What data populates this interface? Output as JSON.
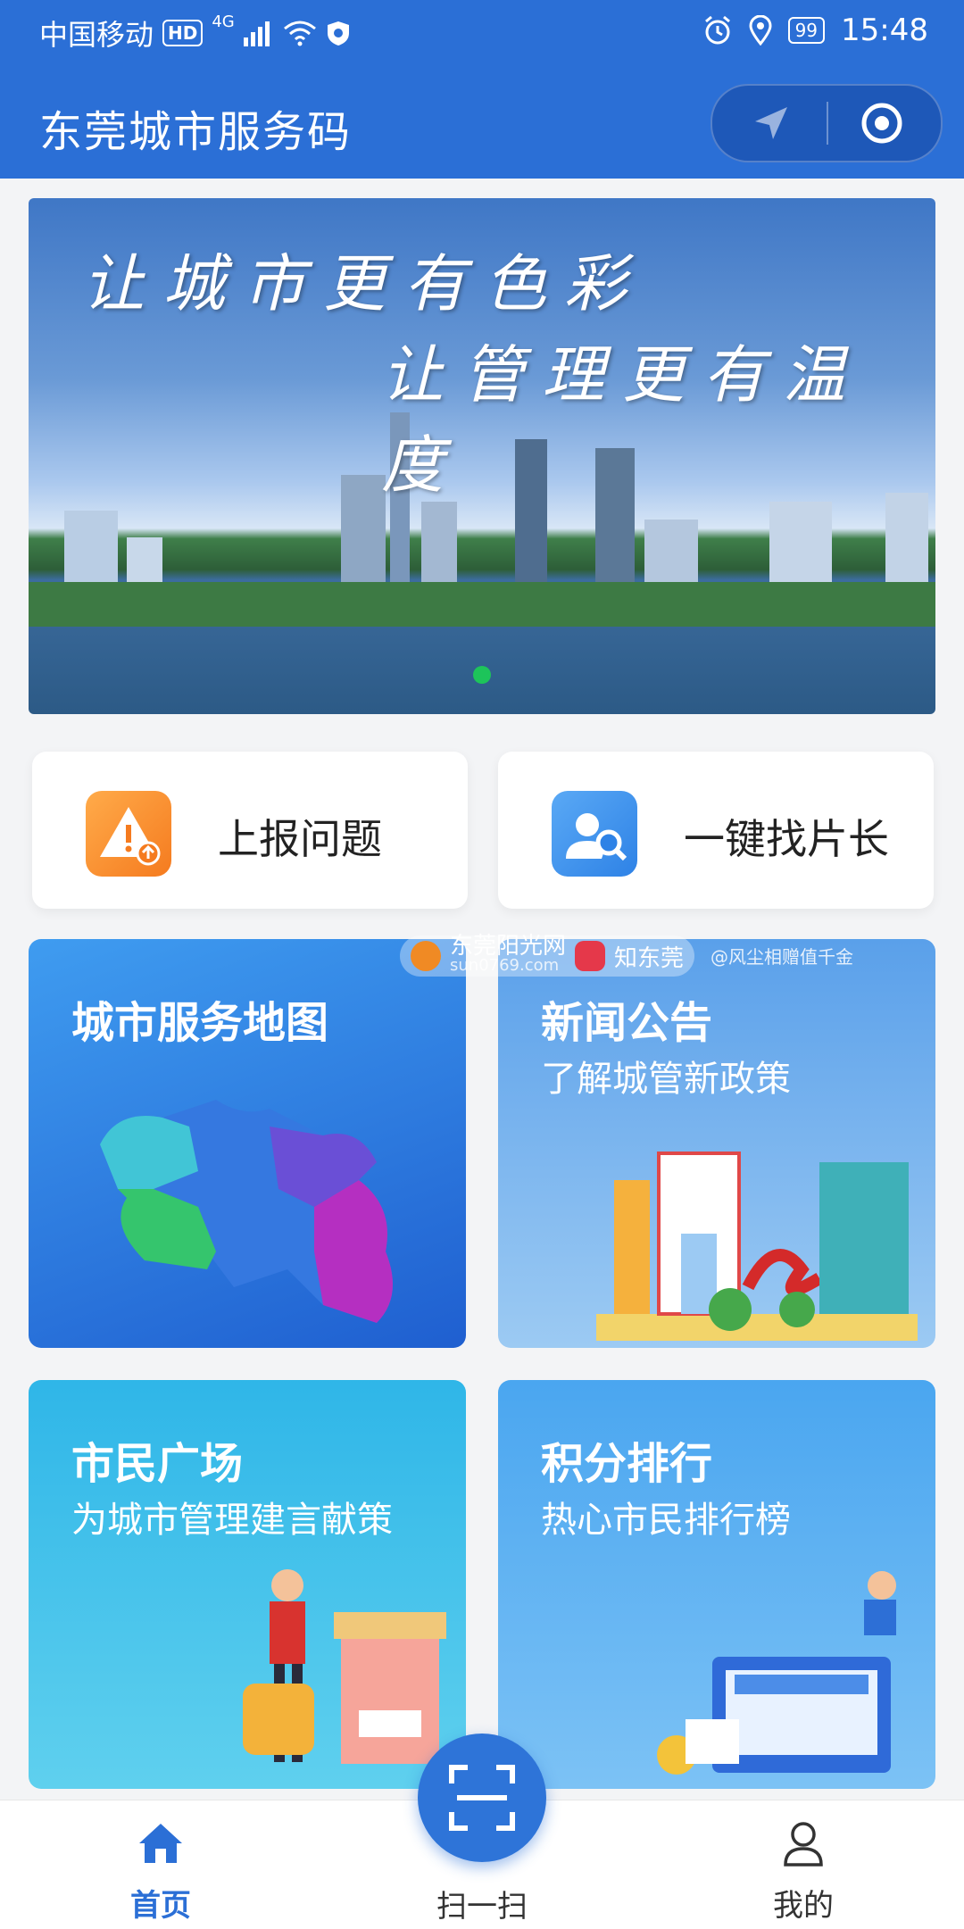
{
  "status_bar": {
    "carrier": "中国移动",
    "hd": "HD",
    "network": "4G",
    "battery": "99",
    "time": "15:48"
  },
  "header": {
    "title": "东莞城市服务码"
  },
  "banner": {
    "line1": "让城市更有色彩",
    "line2": "让管理更有温度"
  },
  "quick_actions": [
    {
      "label": "上报问题",
      "icon": "warning-upload-icon"
    },
    {
      "label": "一键找片长",
      "icon": "user-search-icon"
    }
  ],
  "tiles": [
    {
      "title": "城市服务地图",
      "subtitle": ""
    },
    {
      "title": "新闻公告",
      "subtitle": "了解城管新政策"
    },
    {
      "title": "市民广场",
      "subtitle": "为城市管理建言献策"
    },
    {
      "title": "积分排行",
      "subtitle": "热心市民排行榜"
    }
  ],
  "watermark": {
    "site": "东莞阳光网",
    "domain": "sun0769.com",
    "app": "知东莞",
    "note": "@风尘相赠值千金"
  },
  "tab_bar": {
    "home": "首页",
    "scan": "扫一扫",
    "mine": "我的",
    "active_color": "#2b6fd6"
  }
}
